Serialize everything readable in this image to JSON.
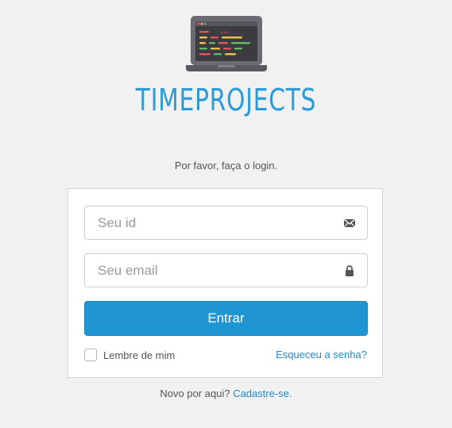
{
  "logo": {
    "brand": "TIMEPROJECTS",
    "icon": "laptop-code-icon"
  },
  "subtitle": "Por favor, faça o login.",
  "form": {
    "id_field": {
      "placeholder": "Seu id",
      "value": "",
      "icon": "envelope-icon"
    },
    "email_field": {
      "placeholder": "Seu email",
      "value": "",
      "icon": "lock-icon"
    },
    "submit_label": "Entrar",
    "remember_label": "Lembre de mim",
    "remember_checked": false,
    "forgot_link": "Esqueceu a senha?"
  },
  "footer": {
    "prompt": "Novo por aqui?",
    "signup_link": "Cadastre-se."
  },
  "colors": {
    "background": "#f1f1f1",
    "brand": "#2a9ad9",
    "primary_button": "#1f95d3",
    "link": "#1f8ac7"
  }
}
